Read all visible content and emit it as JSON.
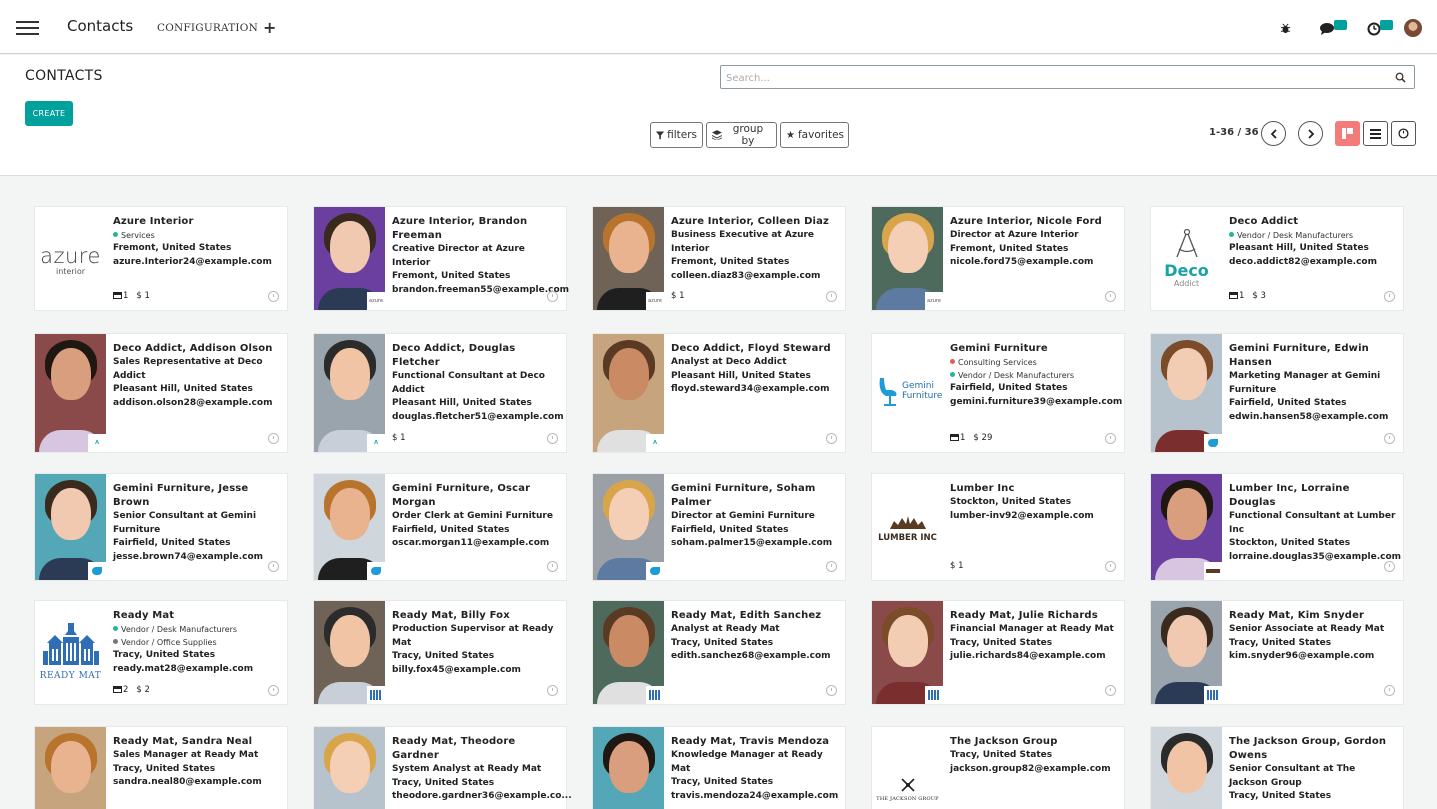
{
  "app": {
    "title": "Contacts",
    "config_menu": "CONFIGURATION",
    "plus": "+"
  },
  "control": {
    "title": "CONTACTS",
    "create_label": "CREATE",
    "search_placeholder": "Search...",
    "filters_label": "filters",
    "group_by_label": "group by",
    "favorites_label": "favorites",
    "pager": "1-36 / 36"
  },
  "colors": {
    "accent": "#00a09d",
    "kanban_active": "#f37b79",
    "tag_green": "#21b799",
    "tag_red": "#e05c5c",
    "tag_gray": "#777777"
  },
  "cards": [
    {
      "name": "Azure Interior",
      "tags": [
        {
          "label": "Services",
          "color": "#21b799"
        }
      ],
      "lines": [
        "Fremont, United States",
        "azure.Interior24@example.com"
      ],
      "footer": [
        "1",
        "$ 1"
      ],
      "footer_icon": true,
      "image": "logo-azure"
    },
    {
      "name": "Azure Interior, Brandon Freeman",
      "tags": [],
      "lines": [
        "Creative Director at Azure Interior",
        "Fremont, United States",
        "brandon.freeman55@example.com"
      ],
      "footer": [],
      "image": "photo-1"
    },
    {
      "name": "Azure Interior, Colleen Diaz",
      "tags": [],
      "lines": [
        "Business Executive at Azure Interior",
        "Fremont, United States",
        "colleen.diaz83@example.com"
      ],
      "footer": [
        "$ 1"
      ],
      "image": "photo-2"
    },
    {
      "name": "Azure Interior, Nicole Ford",
      "tags": [],
      "lines": [
        "Director at Azure Interior",
        "Fremont, United States",
        "nicole.ford75@example.com"
      ],
      "footer": [],
      "image": "photo-3"
    },
    {
      "name": "Deco Addict",
      "tags": [
        {
          "label": "Vendor / Desk Manufacturers",
          "color": "#21b799"
        }
      ],
      "lines": [
        "Pleasant Hill, United States",
        "deco.addict82@example.com"
      ],
      "footer": [
        "1",
        "$ 3"
      ],
      "footer_icon": true,
      "image": "logo-deco"
    },
    {
      "name": "Deco Addict, Addison Olson",
      "tags": [],
      "lines": [
        "Sales Representative at Deco Addict",
        "Pleasant Hill, United States",
        "addison.olson28@example.com"
      ],
      "footer": [],
      "image": "photo-4"
    },
    {
      "name": "Deco Addict, Douglas Fletcher",
      "tags": [],
      "lines": [
        "Functional Consultant at Deco Addict",
        "Pleasant Hill, United States",
        "douglas.fletcher51@example.com"
      ],
      "footer": [
        "$ 1"
      ],
      "image": "photo-5"
    },
    {
      "name": "Deco Addict, Floyd Steward",
      "tags": [],
      "lines": [
        "Analyst at Deco Addict",
        "Pleasant Hill, United States",
        "floyd.steward34@example.com"
      ],
      "footer": [],
      "image": "photo-6"
    },
    {
      "name": "Gemini Furniture",
      "tags": [
        {
          "label": "Consulting Services",
          "color": "#e05c5c"
        },
        {
          "label": "Vendor / Desk Manufacturers",
          "color": "#21b799"
        }
      ],
      "lines": [
        "Fairfield, United States",
        "gemini.furniture39@example.com"
      ],
      "footer": [
        "1",
        "$ 29"
      ],
      "footer_icon": true,
      "image": "logo-gemini"
    },
    {
      "name": "Gemini Furniture, Edwin Hansen",
      "tags": [],
      "lines": [
        "Marketing Manager at Gemini Furniture",
        "Fairfield, United States",
        "edwin.hansen58@example.com"
      ],
      "footer": [],
      "image": "photo-7"
    },
    {
      "name": "Gemini Furniture, Jesse Brown",
      "tags": [],
      "lines": [
        "Senior Consultant at Gemini Furniture",
        "Fairfield, United States",
        "jesse.brown74@example.com"
      ],
      "footer": [],
      "image": "photo-8"
    },
    {
      "name": "Gemini Furniture, Oscar Morgan",
      "tags": [],
      "lines": [
        "Order Clerk at Gemini Furniture",
        "Fairfield, United States",
        "oscar.morgan11@example.com"
      ],
      "footer": [],
      "image": "photo-9"
    },
    {
      "name": "Gemini Furniture, Soham Palmer",
      "tags": [],
      "lines": [
        "Director at Gemini Furniture",
        "Fairfield, United States",
        "soham.palmer15@example.com"
      ],
      "footer": [],
      "image": "photo-10"
    },
    {
      "name": "Lumber Inc",
      "tags": [],
      "lines": [
        "Stockton, United States",
        "lumber-inv92@example.com"
      ],
      "footer": [
        "$ 1"
      ],
      "image": "logo-lumber"
    },
    {
      "name": "Lumber Inc, Lorraine Douglas",
      "tags": [],
      "lines": [
        "Functional Consultant at Lumber Inc",
        "Stockton, United States",
        "lorraine.douglas35@example.com"
      ],
      "footer": [],
      "image": "photo-11"
    },
    {
      "name": "Ready Mat",
      "tags": [
        {
          "label": "Vendor / Desk Manufacturers",
          "color": "#21b799"
        },
        {
          "label": "Vendor / Office Supplies",
          "color": "#777777"
        }
      ],
      "lines": [
        "Tracy, United States",
        "ready.mat28@example.com"
      ],
      "footer": [
        "2",
        "$ 2"
      ],
      "footer_icon": true,
      "image": "logo-readymat"
    },
    {
      "name": "Ready Mat, Billy Fox",
      "tags": [],
      "lines": [
        "Production Supervisor at Ready Mat",
        "Tracy, United States",
        "billy.fox45@example.com"
      ],
      "footer": [],
      "image": "photo-12"
    },
    {
      "name": "Ready Mat, Edith Sanchez",
      "tags": [],
      "lines": [
        "Analyst at Ready Mat",
        "Tracy, United States",
        "edith.sanchez68@example.com"
      ],
      "footer": [],
      "image": "photo-13"
    },
    {
      "name": "Ready Mat, Julie Richards",
      "tags": [],
      "lines": [
        "Financial Manager at Ready Mat",
        "Tracy, United States",
        "julie.richards84@example.com"
      ],
      "footer": [],
      "image": "photo-14"
    },
    {
      "name": "Ready Mat, Kim Snyder",
      "tags": [],
      "lines": [
        "Senior Associate at Ready Mat",
        "Tracy, United States",
        "kim.snyder96@example.com"
      ],
      "footer": [],
      "image": "photo-15"
    },
    {
      "name": "Ready Mat, Sandra Neal",
      "tags": [],
      "lines": [
        "Sales Manager at Ready Mat",
        "Tracy, United States",
        "sandra.neal80@example.com"
      ],
      "footer": [],
      "image": "photo-16"
    },
    {
      "name": "Ready Mat, Theodore Gardner",
      "tags": [],
      "lines": [
        "System Analyst at Ready Mat",
        "Tracy, United States",
        "theodore.gardner36@example.co..."
      ],
      "footer": [],
      "image": "photo-17"
    },
    {
      "name": "Ready Mat, Travis Mendoza",
      "tags": [],
      "lines": [
        "Knowledge Manager at Ready Mat",
        "Tracy, United States",
        "travis.mendoza24@example.com"
      ],
      "footer": [],
      "image": "photo-18"
    },
    {
      "name": "The Jackson Group",
      "tags": [],
      "lines": [
        "Tracy, United States",
        "jackson.group82@example.com"
      ],
      "footer": [],
      "image": "logo-jackson"
    },
    {
      "name": "The Jackson Group, Gordon Owens",
      "tags": [],
      "lines": [
        "Senior Consultant at The Jackson Group",
        "Tracy, United States"
      ],
      "footer": [],
      "image": "photo-19"
    }
  ],
  "logos": {
    "azure_main": "azure",
    "azure_sub": "interior",
    "deco_main": "Deco",
    "deco_sub": "Addict",
    "gemini_main": "Gemini",
    "gemini_sub": "Furniture",
    "lumber": "LUMBER INC",
    "readymat": "READY MAT",
    "jackson": "THE JACKSON GROUP"
  }
}
